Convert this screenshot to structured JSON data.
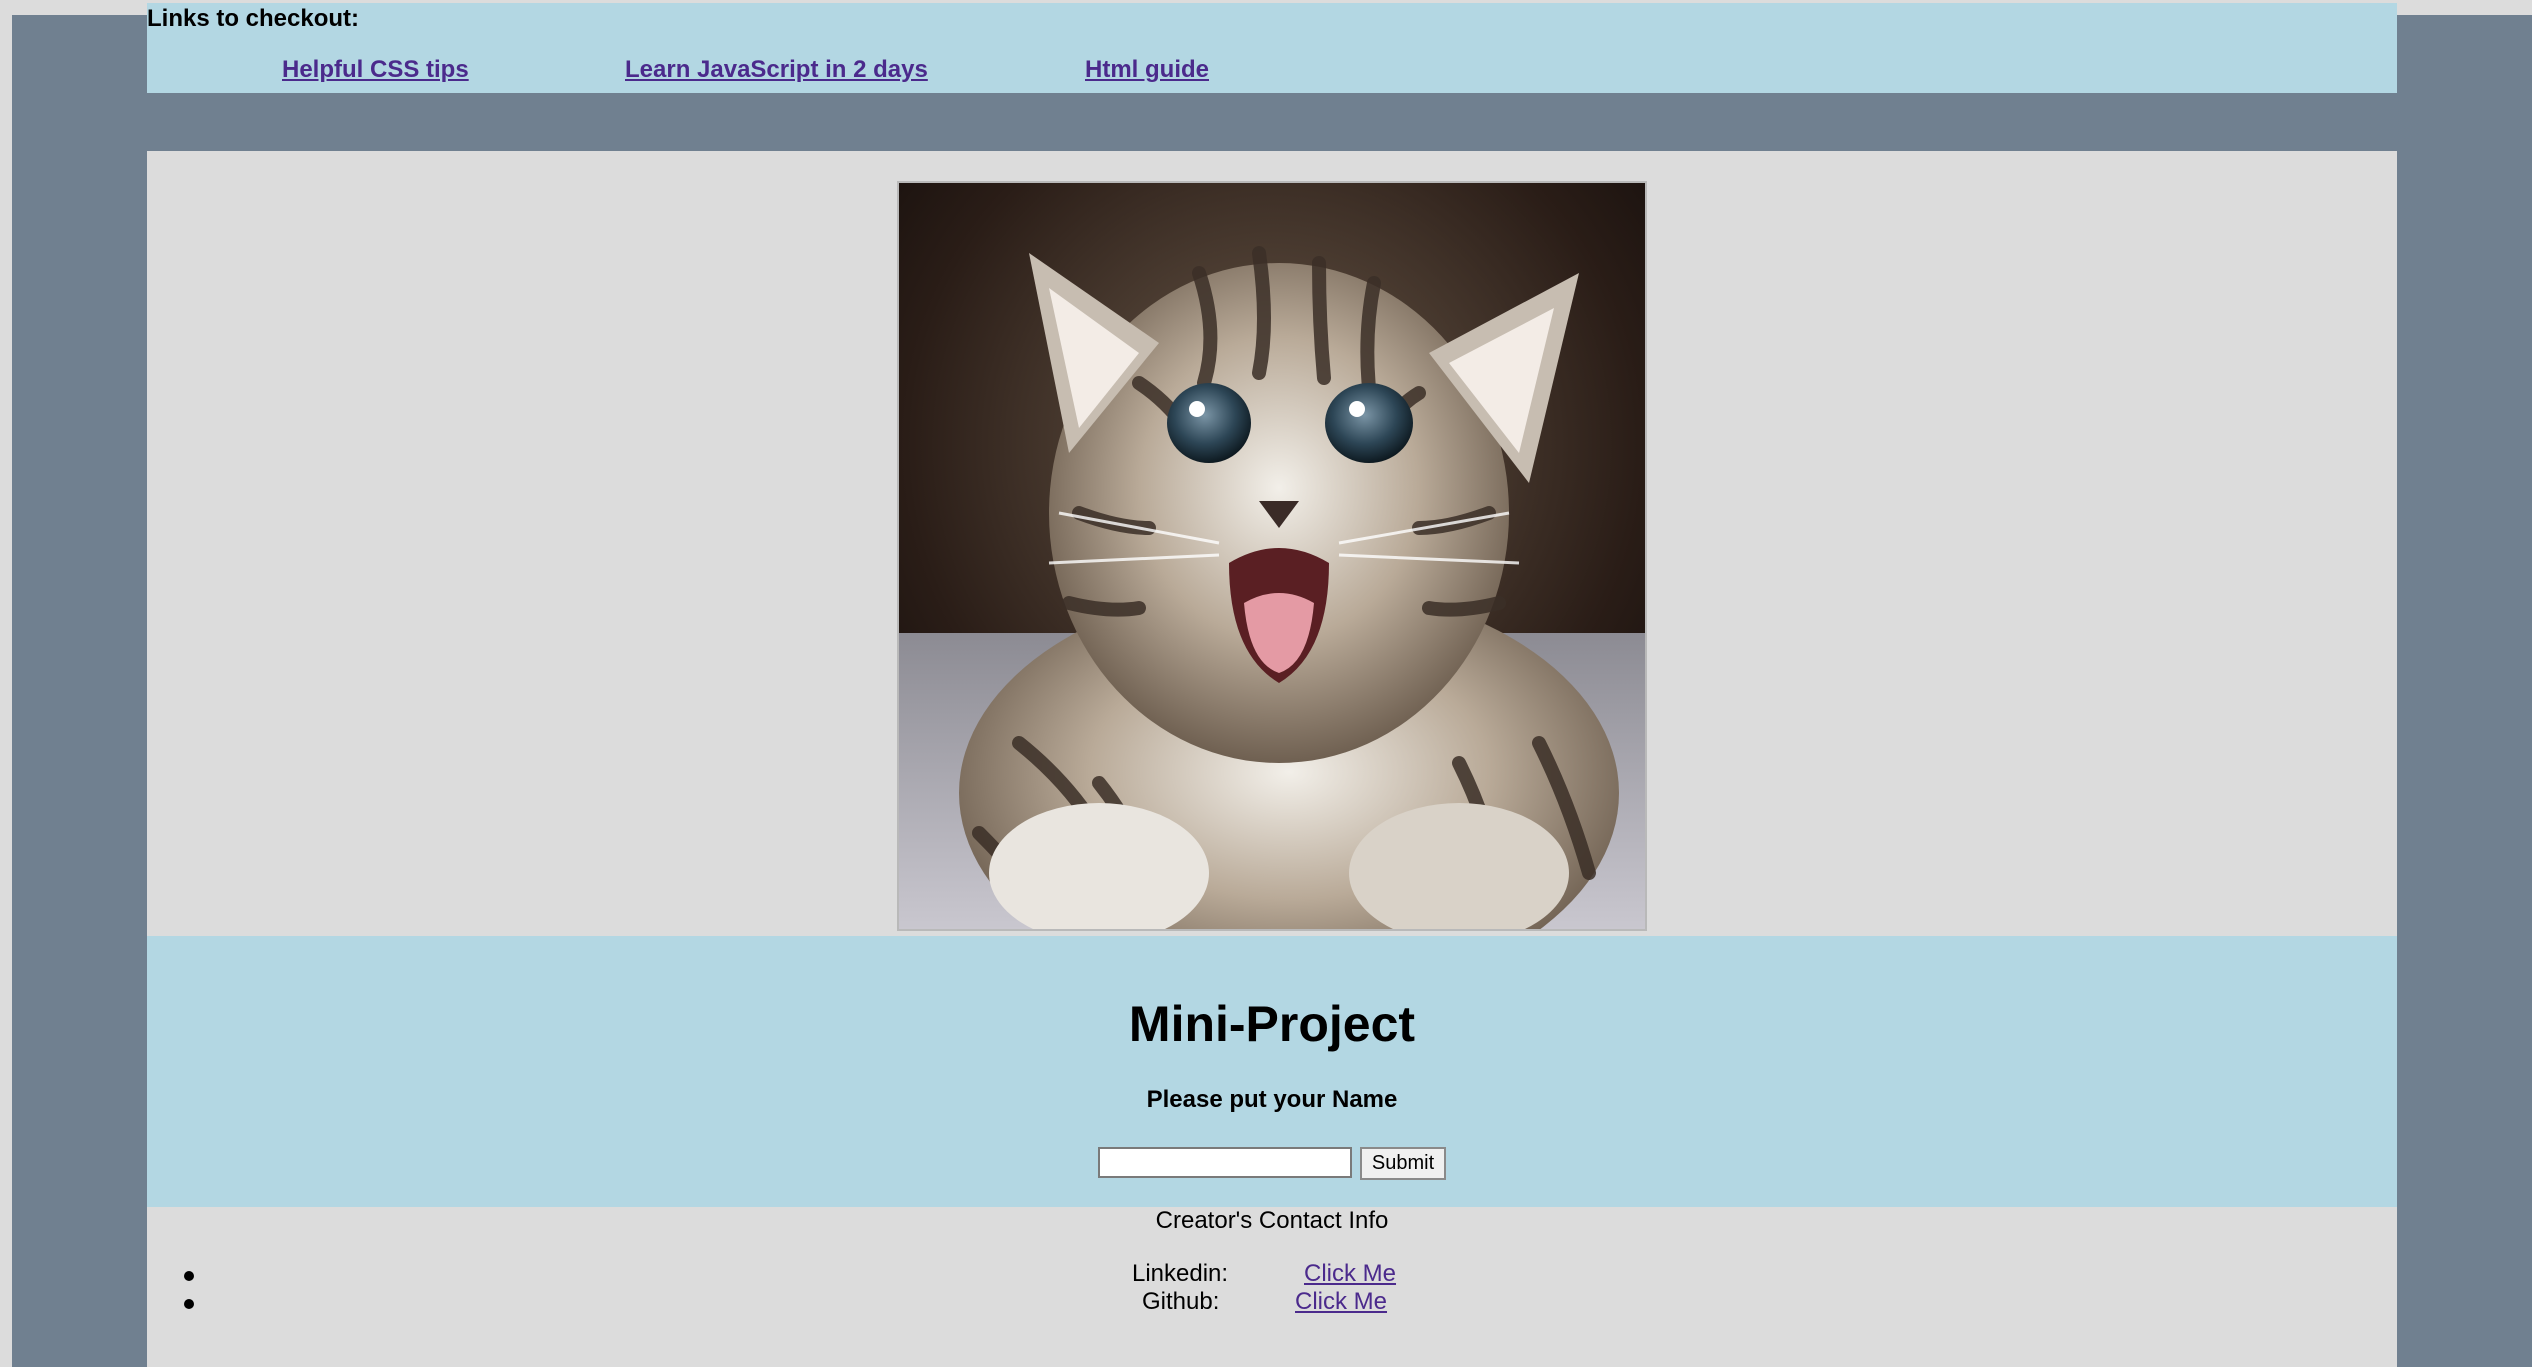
{
  "header": {
    "title": "Links to checkout:",
    "links": [
      {
        "label": "Helpful CSS tips"
      },
      {
        "label": "Learn JavaScript in 2 days"
      },
      {
        "label": "Html guide"
      }
    ]
  },
  "project": {
    "title": "Mini-Project",
    "prompt": "Please put your Name",
    "input_value": "",
    "submit_label": "Submit"
  },
  "footer": {
    "title": "Creator's Contact Info",
    "contacts": [
      {
        "label": "Linkedin:",
        "link": "Click Me"
      },
      {
        "label": "Github:",
        "link": "Click Me"
      }
    ]
  },
  "colors": {
    "frame": "#708090",
    "panel": "#b3d7e3",
    "content": "#dcdcdc",
    "link": "#4b2a8c"
  }
}
